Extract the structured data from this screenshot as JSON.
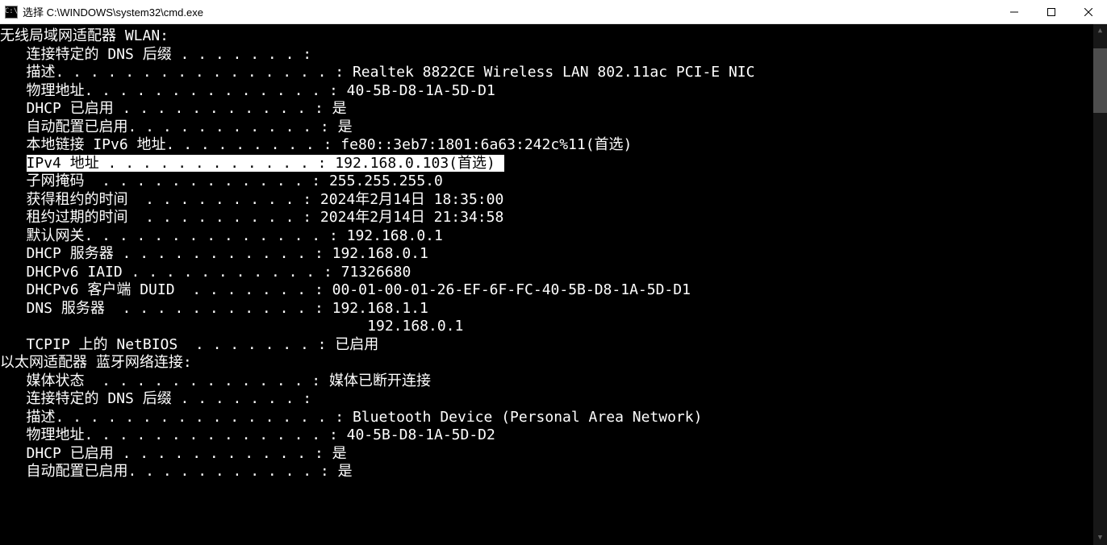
{
  "window": {
    "title": "选择 C:\\WINDOWS\\system32\\cmd.exe",
    "icon_label": "C:\\"
  },
  "adapter1": {
    "header": "无线局域网适配器 WLAN:",
    "rows": [
      {
        "label": "连接特定的 DNS 后缀",
        "dots": " . . . . . . . :",
        "value": "",
        "indent": true
      },
      {
        "label": "描述.",
        "dots": " . . . . . . . . . . . . . . . :",
        "value": " Realtek 8822CE Wireless LAN 802.11ac PCI-E NIC",
        "indent": true
      },
      {
        "label": "物理地址.",
        "dots": " . . . . . . . . . . . . . :",
        "value": " 40-5B-D8-1A-5D-D1",
        "indent": true
      },
      {
        "label": "DHCP 已启用",
        "dots": " . . . . . . . . . . . :",
        "value": " 是",
        "indent": true
      },
      {
        "label": "自动配置已启用.",
        "dots": " . . . . . . . . . . :",
        "value": " 是",
        "indent": true
      },
      {
        "label": "本地链接 IPv6 地址.",
        "dots": " . . . . . . . . :",
        "value": " fe80::3eb7:1801:6a63:242c%11(首选)",
        "indent": true
      },
      {
        "label": "IPv4 地址",
        "dots": " . . . . . . . . . . . . :",
        "value": " 192.168.0.103(首选)",
        "indent": true,
        "highlight": true
      },
      {
        "label": "子网掩码 ",
        "dots": " . . . . . . . . . . . . :",
        "value": " 255.255.255.0",
        "indent": true
      },
      {
        "label": "获得租约的时间 ",
        "dots": " . . . . . . . . . :",
        "value": " 2024年2月14日 18:35:00",
        "indent": true
      },
      {
        "label": "租约过期的时间 ",
        "dots": " . . . . . . . . . :",
        "value": " 2024年2月14日 21:34:58",
        "indent": true
      },
      {
        "label": "默认网关.",
        "dots": " . . . . . . . . . . . . . :",
        "value": " 192.168.0.1",
        "indent": true
      },
      {
        "label": "DHCP 服务器",
        "dots": " . . . . . . . . . . . :",
        "value": " 192.168.0.1",
        "indent": true
      },
      {
        "label": "DHCPv6 IAID",
        "dots": " . . . . . . . . . . . :",
        "value": " 71326680",
        "indent": true
      },
      {
        "label": "DHCPv6 客户端 DUID ",
        "dots": " . . . . . . . :",
        "value": " 00-01-00-01-26-EF-6F-FC-40-5B-D8-1A-5D-D1",
        "indent": true
      },
      {
        "label": "DNS 服务器 ",
        "dots": " . . . . . . . . . . . :",
        "value": " 192.168.1.1",
        "indent": true
      },
      {
        "label": "",
        "dots": "                                       ",
        "value": "192.168.0.1",
        "indent": true
      },
      {
        "label": "TCPIP 上的 NetBIOS ",
        "dots": " . . . . . . . :",
        "value": " 已启用",
        "indent": true
      }
    ]
  },
  "adapter2": {
    "header": "以太网适配器 蓝牙网络连接:",
    "rows": [
      {
        "label": "媒体状态 ",
        "dots": " . . . . . . . . . . . . :",
        "value": " 媒体已断开连接",
        "indent": true
      },
      {
        "label": "连接特定的 DNS 后缀",
        "dots": " . . . . . . . :",
        "value": "",
        "indent": true
      },
      {
        "label": "描述.",
        "dots": " . . . . . . . . . . . . . . . :",
        "value": " Bluetooth Device (Personal Area Network)",
        "indent": true
      },
      {
        "label": "物理地址.",
        "dots": " . . . . . . . . . . . . . :",
        "value": " 40-5B-D8-1A-5D-D2",
        "indent": true
      },
      {
        "label": "DHCP 已启用",
        "dots": " . . . . . . . . . . . :",
        "value": " 是",
        "indent": true
      },
      {
        "label": "自动配置已启用.",
        "dots": " . . . . . . . . . . :",
        "value": " 是",
        "indent": true
      }
    ]
  }
}
